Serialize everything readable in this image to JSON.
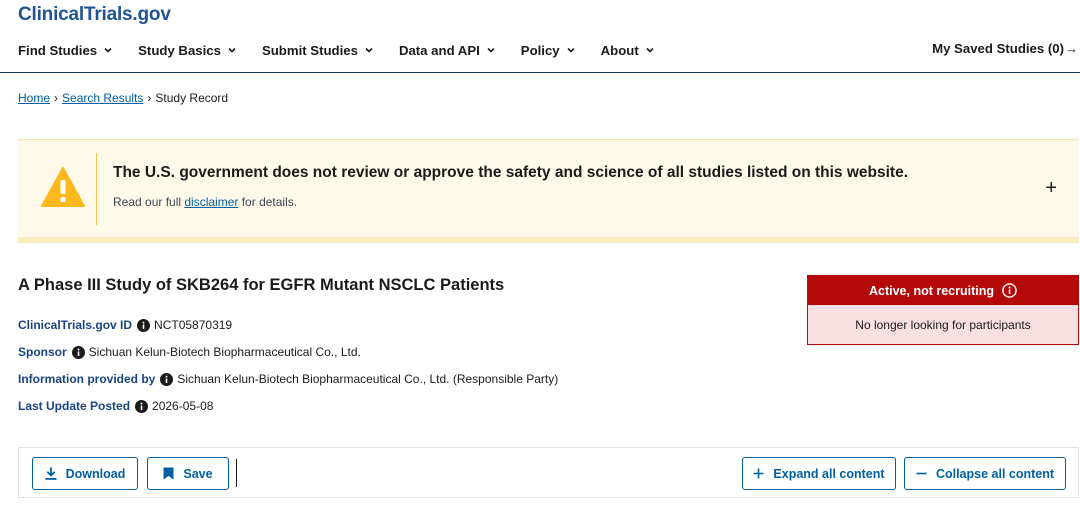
{
  "header": {
    "logo_main": "ClinicalTrials",
    "logo_suffix": ".gov",
    "nav": [
      {
        "label": "Find Studies"
      },
      {
        "label": "Study Basics"
      },
      {
        "label": "Submit Studies"
      },
      {
        "label": "Data and API"
      },
      {
        "label": "Policy"
      },
      {
        "label": "About"
      }
    ],
    "saved_label": "My Saved Studies (0)",
    "saved_arrow": "→"
  },
  "breadcrumb": {
    "home": "Home",
    "sep1": "›",
    "search_results": "Search Results",
    "sep2": "›",
    "current": "Study Record"
  },
  "disclaimer": {
    "title": "The U.S. government does not review or approve the safety and science of all studies listed on this website.",
    "sub_before": "Read our full ",
    "sub_link": "disclaimer",
    "sub_after": " for details.",
    "expand_symbol": "+"
  },
  "study": {
    "title": "A Phase III Study of SKB264 for EGFR Mutant NSCLC Patients",
    "id_label": "ClinicalTrials.gov ID",
    "id_value": "NCT05870319",
    "sponsor_label": "Sponsor",
    "sponsor_value": "Sichuan Kelun-Biotech Biopharmaceutical Co., Ltd.",
    "info_label": "Information provided by",
    "info_value": "Sichuan Kelun-Biotech Biopharmaceutical Co., Ltd. (Responsible Party)",
    "update_label": "Last Update Posted",
    "update_value": "2026-05-08"
  },
  "status": {
    "head": "Active, not recruiting",
    "body": "No longer looking for participants"
  },
  "toolbar": {
    "download": "Download",
    "save": "Save",
    "expand": "Expand all content",
    "collapse": "Collapse all content"
  },
  "colors": {
    "brand": "#205493",
    "link": "#005ea2",
    "status_red": "#b50909",
    "status_bg": "#f8dfe2",
    "warning_yellow": "#fdb81e",
    "disclaimer_bg": "#fef9e9"
  }
}
